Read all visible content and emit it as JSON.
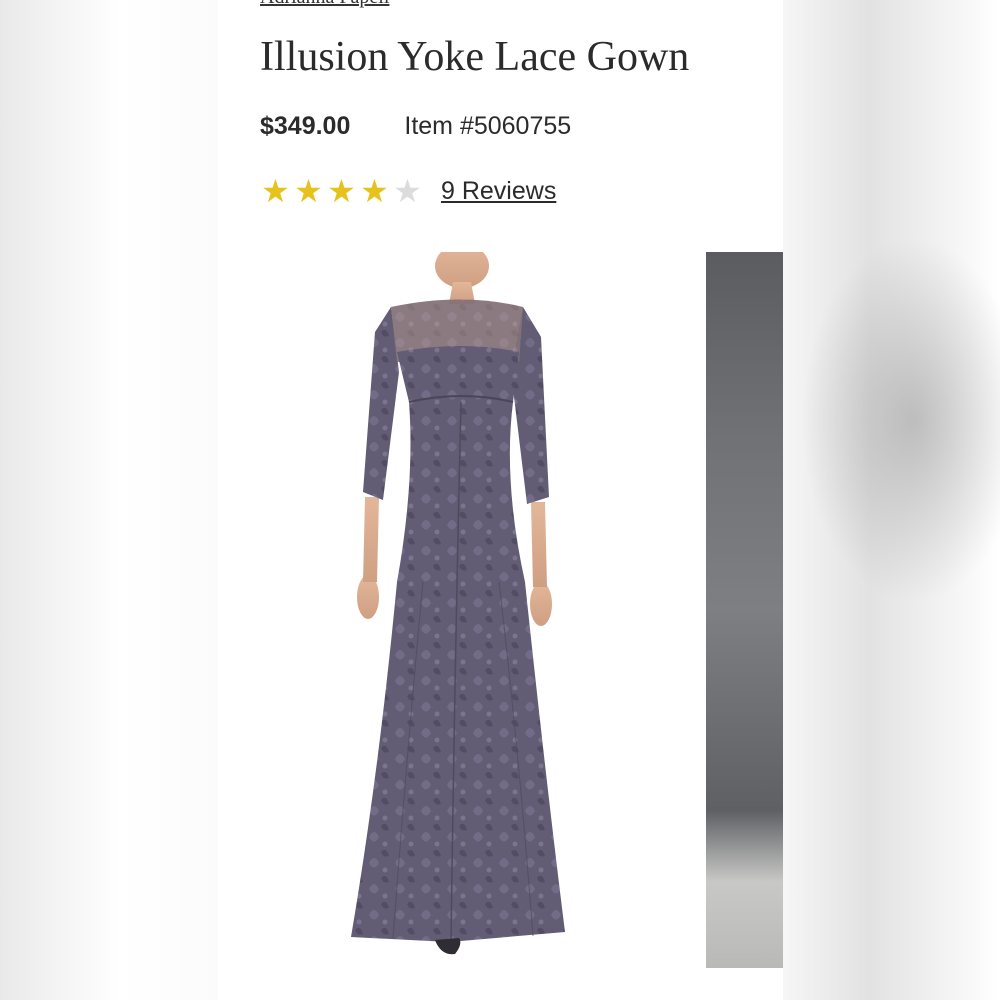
{
  "product": {
    "breadcrumb": "Adrianna Papell",
    "title": "Illusion Yoke Lace Gown",
    "price": "$349.00",
    "item_number": "Item #5060755",
    "rating": {
      "value": 4,
      "max": 5
    },
    "reviews_label": "9 Reviews"
  },
  "icons": {
    "star_filled": "star-filled-icon",
    "star_empty": "star-empty-icon"
  },
  "colors": {
    "star_filled": "#e8c21c",
    "star_empty": "#dcdcdc",
    "gown": "#5f5a70",
    "text": "#2b2b2b"
  }
}
